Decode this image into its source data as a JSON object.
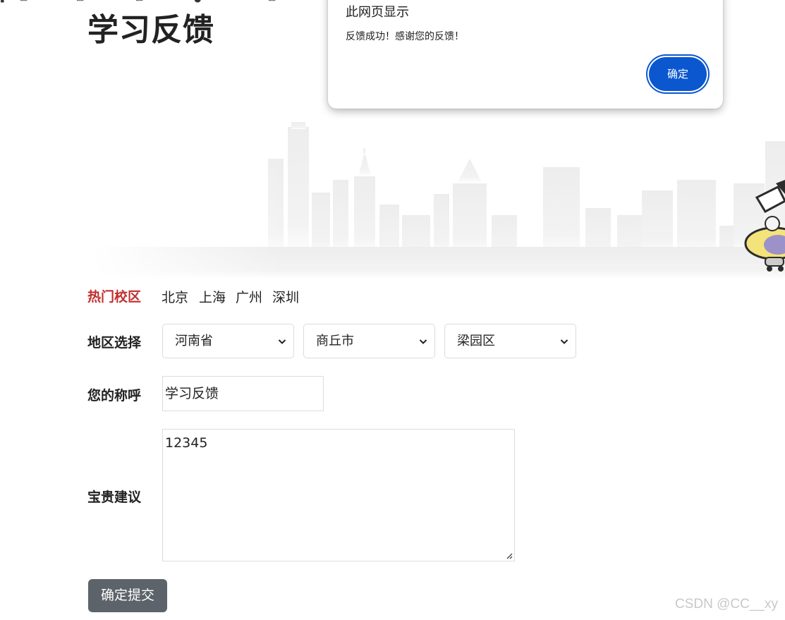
{
  "page_title": "学习反馈",
  "form": {
    "hot_campus_label": "热门校区",
    "campuses": [
      "北京",
      "上海",
      "广州",
      "深圳"
    ],
    "region_label": "地区选择",
    "province": "河南省",
    "city": "商丘市",
    "district": "梁园区",
    "name_label": "您的称呼",
    "name_value": "学习反馈",
    "suggestion_label": "宝贵建议",
    "suggestion_value": "12345",
    "submit_label": "确定提交"
  },
  "dialog": {
    "title": "此网页显示",
    "message": "反馈成功！感谢您的反馈！",
    "ok_label": "确定"
  },
  "watermark": "CSDN @CC__xy",
  "colors": {
    "hot_label": "#c0302f",
    "submit_bg": "#5c636a",
    "dialog_button": "#0b57d0"
  }
}
